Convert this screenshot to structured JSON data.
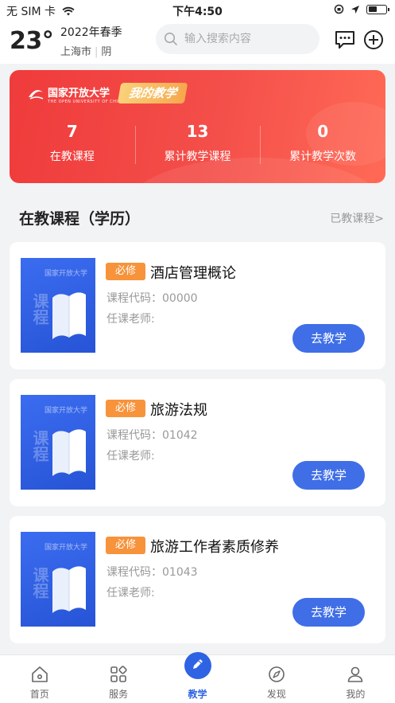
{
  "status_bar": {
    "carrier": "无 SIM 卡",
    "time": "下午4:50"
  },
  "header": {
    "temperature": "23°",
    "semester": "2022年春季",
    "city": "上海市",
    "weather": "阴",
    "search_placeholder": "输入搜索内容"
  },
  "banner": {
    "logo_title": "国家开放大学",
    "logo_subtitle": "THE OPEN UNIVERSITY OF CHINA",
    "tag": "我的教学",
    "stats": [
      {
        "value": "7",
        "label": "在教课程"
      },
      {
        "value": "13",
        "label": "累计教学课程"
      },
      {
        "value": "0",
        "label": "累计教学次数"
      }
    ]
  },
  "section": {
    "title": "在教课程（学历）",
    "link": "已教课程>"
  },
  "courses": [
    {
      "badge": "必修",
      "name": "酒店管理概论",
      "code": "课程代码：00000",
      "teacher": "任课老师:",
      "button": "去教学"
    },
    {
      "badge": "必修",
      "name": "旅游法规",
      "code": "课程代码：01042",
      "teacher": "任课老师:",
      "button": "去教学"
    },
    {
      "badge": "必修",
      "name": "旅游工作者素质修养",
      "code": "课程代码：01043",
      "teacher": "任课老师:",
      "button": "去教学"
    }
  ],
  "cover": {
    "title": "国家开放大学",
    "big": "课程"
  },
  "tabbar": [
    {
      "label": "首页",
      "icon": "home-icon"
    },
    {
      "label": "服务",
      "icon": "grid-icon"
    },
    {
      "label": "教学",
      "icon": "pen-icon",
      "active": true
    },
    {
      "label": "发现",
      "icon": "compass-icon"
    },
    {
      "label": "我的",
      "icon": "user-icon"
    }
  ],
  "colors": {
    "accent": "#2e63e3",
    "banner": "#f04a44",
    "badge": "#f7933b",
    "button": "#3f6ee7"
  }
}
